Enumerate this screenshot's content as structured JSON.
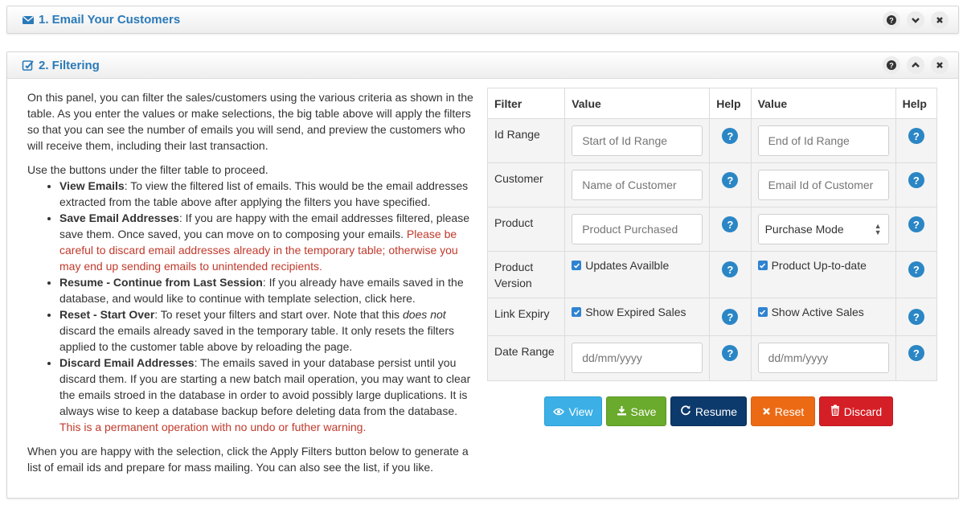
{
  "panel1": {
    "title": "1. Email Your Customers",
    "icons": [
      "envelope-icon",
      "question-icon",
      "chevron-down-icon",
      "close-icon"
    ]
  },
  "panel2": {
    "title": "2. Filtering",
    "icons": [
      "edit-icon",
      "question-icon",
      "chevron-up-icon",
      "close-icon"
    ],
    "intro": "On this panel, you can filter the sales/customers using the various criteria as shown in the table. As you enter the values or make selections, the big table above will apply the filters so that you can see the number of emails you will send, and preview the customers who will receive them, including their last transaction.",
    "use_buttons": "Use the buttons under the filter table to proceed.",
    "items": [
      {
        "title": "View Emails",
        "text": ": To view the filtered list of emails. This would be the email addresses extracted from the table above after applying the filters you have specified."
      },
      {
        "title": "Save Email Addresses",
        "text": ": If you are happy with the email addresses filtered, please save them. Once saved, you can move on to composing your emails. ",
        "warning": "Please be careful to discard email addresses already in the temporary table; otherwise you may end up sending emails to unintended recipients."
      },
      {
        "title": "Resume - Continue from Last Session",
        "text": ": If you already have emails saved in the database, and would like to continue with template selection, click here."
      },
      {
        "title": "Reset - Start Over",
        "text": ": To reset your filters and start over. Note that this ",
        "emphasis": "does not",
        "text2": " discard the emails already saved in the temporary table. It only resets the filters applied to the customer table above by reloading the page."
      },
      {
        "title": "Discard Email Addresses",
        "text": ": The emails saved in your database persist until you discard them. If you are starting a new batch mail operation, you may want to clear the emails stroed in the database in order to avoid possibly large duplications. It is always wise to keep a database backup before deleting data from the database. ",
        "warning": "This is a permanent operation with no undo or futher warning."
      }
    ],
    "outro": "When you are happy with the selection, click the Apply Filters button below to generate a list of email ids and prepare for mass mailing. You can also see the list, if you like."
  },
  "table": {
    "headers": [
      "Filter",
      "Value",
      "Help",
      "Value",
      "Help"
    ],
    "help_symbol": "?",
    "rows": [
      {
        "label": "Id Range",
        "left": {
          "type": "input",
          "placeholder": "Start of Id Range"
        },
        "right": {
          "type": "input",
          "placeholder": "End of Id Range"
        }
      },
      {
        "label": "Customer",
        "left": {
          "type": "input",
          "placeholder": "Name of Customer"
        },
        "right": {
          "type": "input",
          "placeholder": "Email Id of Customer"
        }
      },
      {
        "label": "Product",
        "left": {
          "type": "input",
          "placeholder": "Product Purchased"
        },
        "right": {
          "type": "select",
          "value": "Purchase Mode"
        }
      },
      {
        "label": "Product Version",
        "left": {
          "type": "checkbox",
          "label": "Updates Availble",
          "checked": true
        },
        "right": {
          "type": "checkbox",
          "label": "Product Up-to-date",
          "checked": true
        }
      },
      {
        "label": "Link Expiry",
        "left": {
          "type": "checkbox",
          "label": "Show Expired Sales",
          "checked": true
        },
        "right": {
          "type": "checkbox",
          "label": "Show Active Sales",
          "checked": true
        }
      },
      {
        "label": "Date Range",
        "left": {
          "type": "input",
          "placeholder": "dd/mm/yyyy"
        },
        "right": {
          "type": "input",
          "placeholder": "dd/mm/yyyy"
        }
      }
    ]
  },
  "buttons": {
    "view": "View",
    "save": "Save",
    "resume": "Resume",
    "reset": "Reset",
    "discard": "Discard",
    "colors": {
      "view": "#3bafe6",
      "save": "#6aaa2c",
      "resume": "#0d3a6c",
      "reset": "#ec6a14",
      "discard": "#d51f26"
    }
  },
  "colors": {
    "panel_title": "#2a7ab8",
    "help_icon": "#2b86c5",
    "warning_text": "#c0392b"
  }
}
